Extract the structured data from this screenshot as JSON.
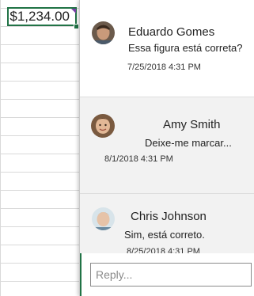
{
  "cell": {
    "value": "$1,234.00"
  },
  "comments": [
    {
      "author": "Eduardo Gomes",
      "text": "Essa figura está correta?",
      "timestamp": "7/25/2018 4:31 PM"
    },
    {
      "author": "Amy Smith",
      "text": "Deixe-me marcar...",
      "timestamp": "8/1/2018 4:31 PM"
    },
    {
      "author": "Chris Johnson",
      "text": "Sim, está correto.",
      "timestamp": "8/25/2018 4:31 PM"
    }
  ],
  "reply": {
    "placeholder": "Reply..."
  },
  "colors": {
    "accent": "#217346",
    "comment_indicator": "#7b3fa8",
    "thread_bg": "#f2f2f2"
  },
  "icons": [
    "avatar-eduardo",
    "avatar-amy",
    "avatar-chris"
  ]
}
